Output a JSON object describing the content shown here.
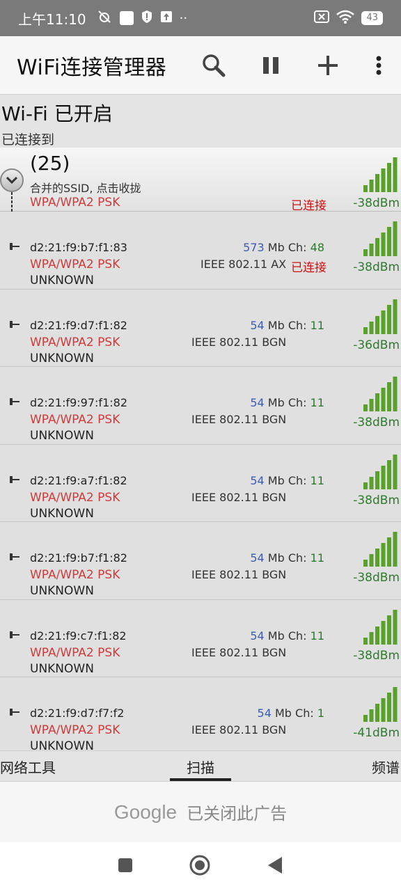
{
  "status_bar": {
    "time": "上午11:10",
    "battery": "43"
  },
  "app_bar": {
    "title": "WiFi连接管理器"
  },
  "wifi_state": {
    "title": "Wi-Fi 已开启",
    "subtitle": "已连接到"
  },
  "group": {
    "count": "(25)",
    "hint": "合并的SSID, 点击收拢",
    "security": "WPA/WPA2 PSK",
    "connected": "已连接",
    "signal": "-38dBm"
  },
  "access_points": [
    {
      "mac": "d2:21:f9:b7:f1:83",
      "rate": "573",
      "rate_unit": "Mb Ch:",
      "channel": "48",
      "security": "WPA/WPA2 PSK",
      "standard": "IEEE 802.11 AX",
      "connected": "已连接",
      "other": "UNKNOWN",
      "signal": "-38dBm"
    },
    {
      "mac": "d2:21:f9:d7:f1:82",
      "rate": "54",
      "rate_unit": "Mb Ch:",
      "channel": "11",
      "security": "WPA/WPA2 PSK",
      "standard": "IEEE 802.11 BGN",
      "connected": "",
      "other": "UNKNOWN",
      "signal": "-36dBm"
    },
    {
      "mac": "d2:21:f9:97:f1:82",
      "rate": "54",
      "rate_unit": "Mb Ch:",
      "channel": "11",
      "security": "WPA/WPA2 PSK",
      "standard": "IEEE 802.11 BGN",
      "connected": "",
      "other": "UNKNOWN",
      "signal": "-38dBm"
    },
    {
      "mac": "d2:21:f9:a7:f1:82",
      "rate": "54",
      "rate_unit": "Mb Ch:",
      "channel": "11",
      "security": "WPA/WPA2 PSK",
      "standard": "IEEE 802.11 BGN",
      "connected": "",
      "other": "UNKNOWN",
      "signal": "-38dBm"
    },
    {
      "mac": "d2:21:f9:b7:f1:82",
      "rate": "54",
      "rate_unit": "Mb Ch:",
      "channel": "11",
      "security": "WPA/WPA2 PSK",
      "standard": "IEEE 802.11 BGN",
      "connected": "",
      "other": "UNKNOWN",
      "signal": "-38dBm"
    },
    {
      "mac": "d2:21:f9:c7:f1:82",
      "rate": "54",
      "rate_unit": "Mb Ch:",
      "channel": "11",
      "security": "WPA/WPA2 PSK",
      "standard": "IEEE 802.11 BGN",
      "connected": "",
      "other": "UNKNOWN",
      "signal": "-38dBm"
    },
    {
      "mac": "d2:21:f9:d7:f7:f2",
      "rate": "54",
      "rate_unit": "Mb Ch:",
      "channel": "1",
      "security": "WPA/WPA2 PSK",
      "standard": "IEEE 802.11 BGN",
      "connected": "",
      "other": "UNKNOWN",
      "signal": "-41dBm"
    }
  ],
  "tabs": {
    "network_tools": "网络工具",
    "scan": "扫描",
    "spectrum": "频谱"
  },
  "ad": {
    "brand": "Google",
    "text": "已关闭此广告"
  },
  "colors": {
    "signal_green": "#5aa02c",
    "security_red": "#d03a3a",
    "connected_red": "#d01010"
  },
  "icons": [
    "search-icon",
    "pause-icon",
    "add-icon",
    "more-vert-icon",
    "chevron-down-icon",
    "wifi-signal-icon",
    "square-nav-icon",
    "home-nav-icon",
    "back-nav-icon"
  ]
}
